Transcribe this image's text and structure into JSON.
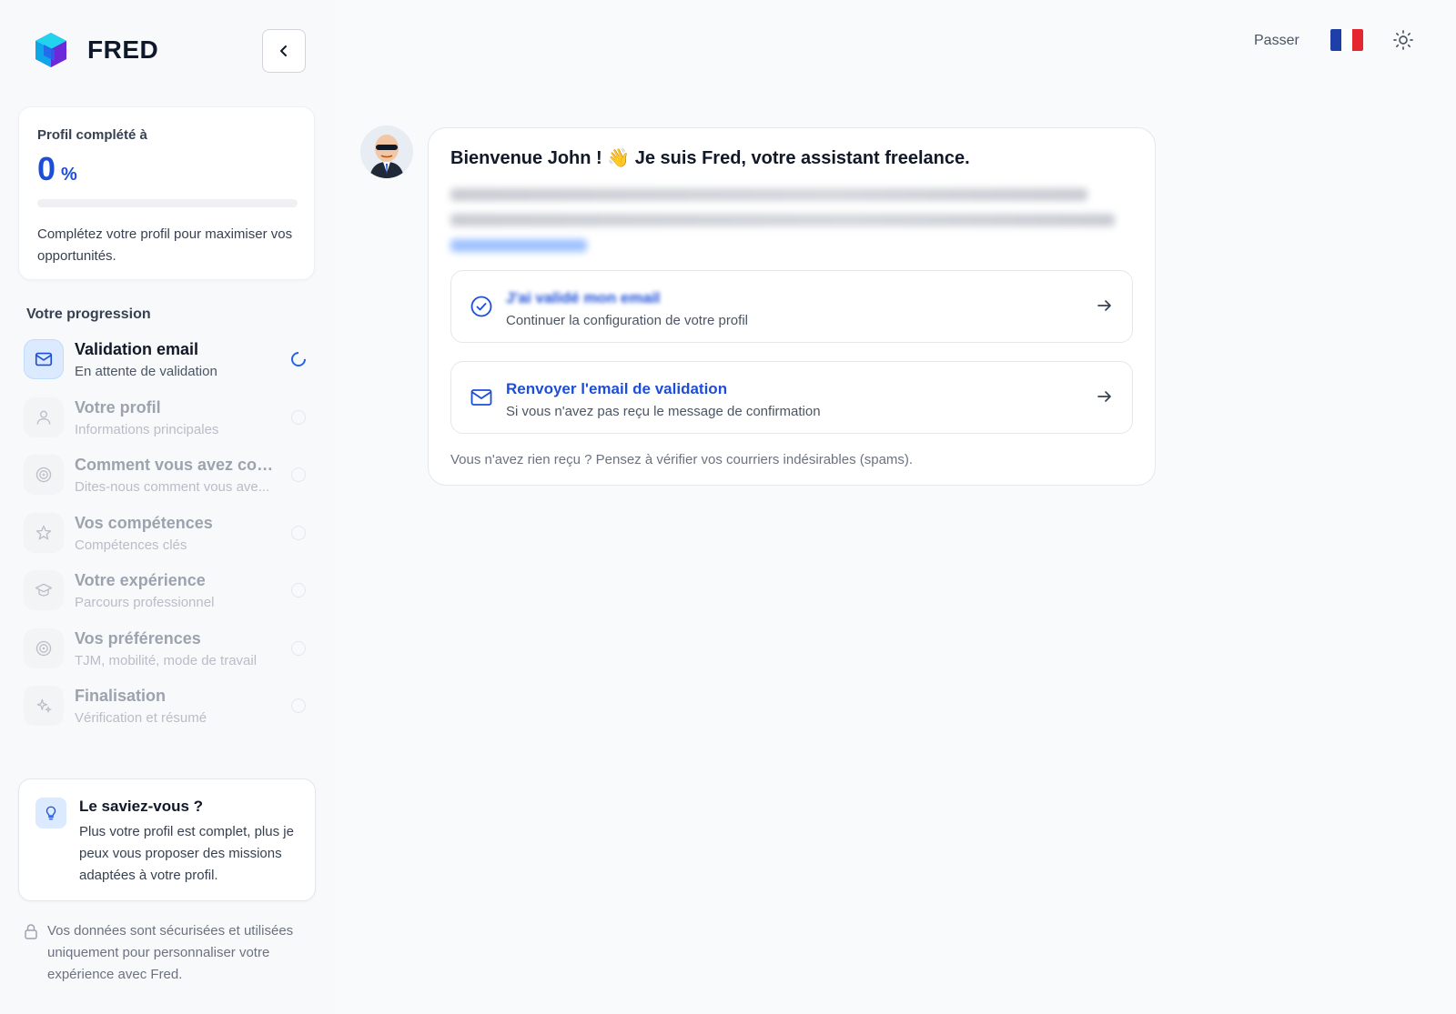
{
  "brand": {
    "name": "FRED"
  },
  "profile": {
    "label": "Profil complété à",
    "percent": 0,
    "percent_text": "0",
    "percent_sign": "%",
    "description": "Complétez votre profil pour maximiser vos opportunités."
  },
  "progress_section": {
    "title": "Votre progression",
    "steps": [
      {
        "title": "Validation email",
        "subtitle": "En attente de validation",
        "icon": "mail-icon",
        "state": "active"
      },
      {
        "title": "Votre profil",
        "subtitle": "Informations principales",
        "icon": "user-icon",
        "state": "pending"
      },
      {
        "title": "Comment vous avez con...",
        "subtitle": "Dites-nous comment vous ave...",
        "icon": "target-icon",
        "state": "pending"
      },
      {
        "title": "Vos compétences",
        "subtitle": "Compétences clés",
        "icon": "star-icon",
        "state": "pending"
      },
      {
        "title": "Votre expérience",
        "subtitle": "Parcours professionnel",
        "icon": "graduation-cap-icon",
        "state": "pending"
      },
      {
        "title": "Vos préférences",
        "subtitle": "TJM, mobilité, mode de travail",
        "icon": "target-icon",
        "state": "pending"
      },
      {
        "title": "Finalisation",
        "subtitle": "Vérification et résumé",
        "icon": "sparkles-icon",
        "state": "pending"
      }
    ]
  },
  "tip": {
    "title": "Le saviez-vous ?",
    "text": "Plus votre profil est complet, plus je peux vous proposer des missions adaptées à votre profil."
  },
  "security_note": "Vos données sont sécurisées et utilisées uniquement pour personnaliser votre expérience avec Fred.",
  "header": {
    "skip_label": "Passer",
    "flag_colors": [
      "#1f3fa8",
      "#ffffff",
      "#e3262f"
    ]
  },
  "chat": {
    "title": "Bienvenue John ! 👋 Je suis Fred, votre assistant freelance.",
    "actions": [
      {
        "title": "J'ai validé mon email",
        "subtitle": "Continuer la configuration de votre profil",
        "icon": "check-circle-icon"
      },
      {
        "title": "Renvoyer l'email de validation",
        "subtitle": "Si vous n'avez pas reçu le message de confirmation",
        "icon": "mail-icon"
      }
    ],
    "hint": "Vous n'avez rien reçu ? Pensez à vérifier vos courriers indésirables (spams)."
  },
  "colors": {
    "accent": "#2563eb",
    "accent_dark": "#1d4ed8"
  }
}
